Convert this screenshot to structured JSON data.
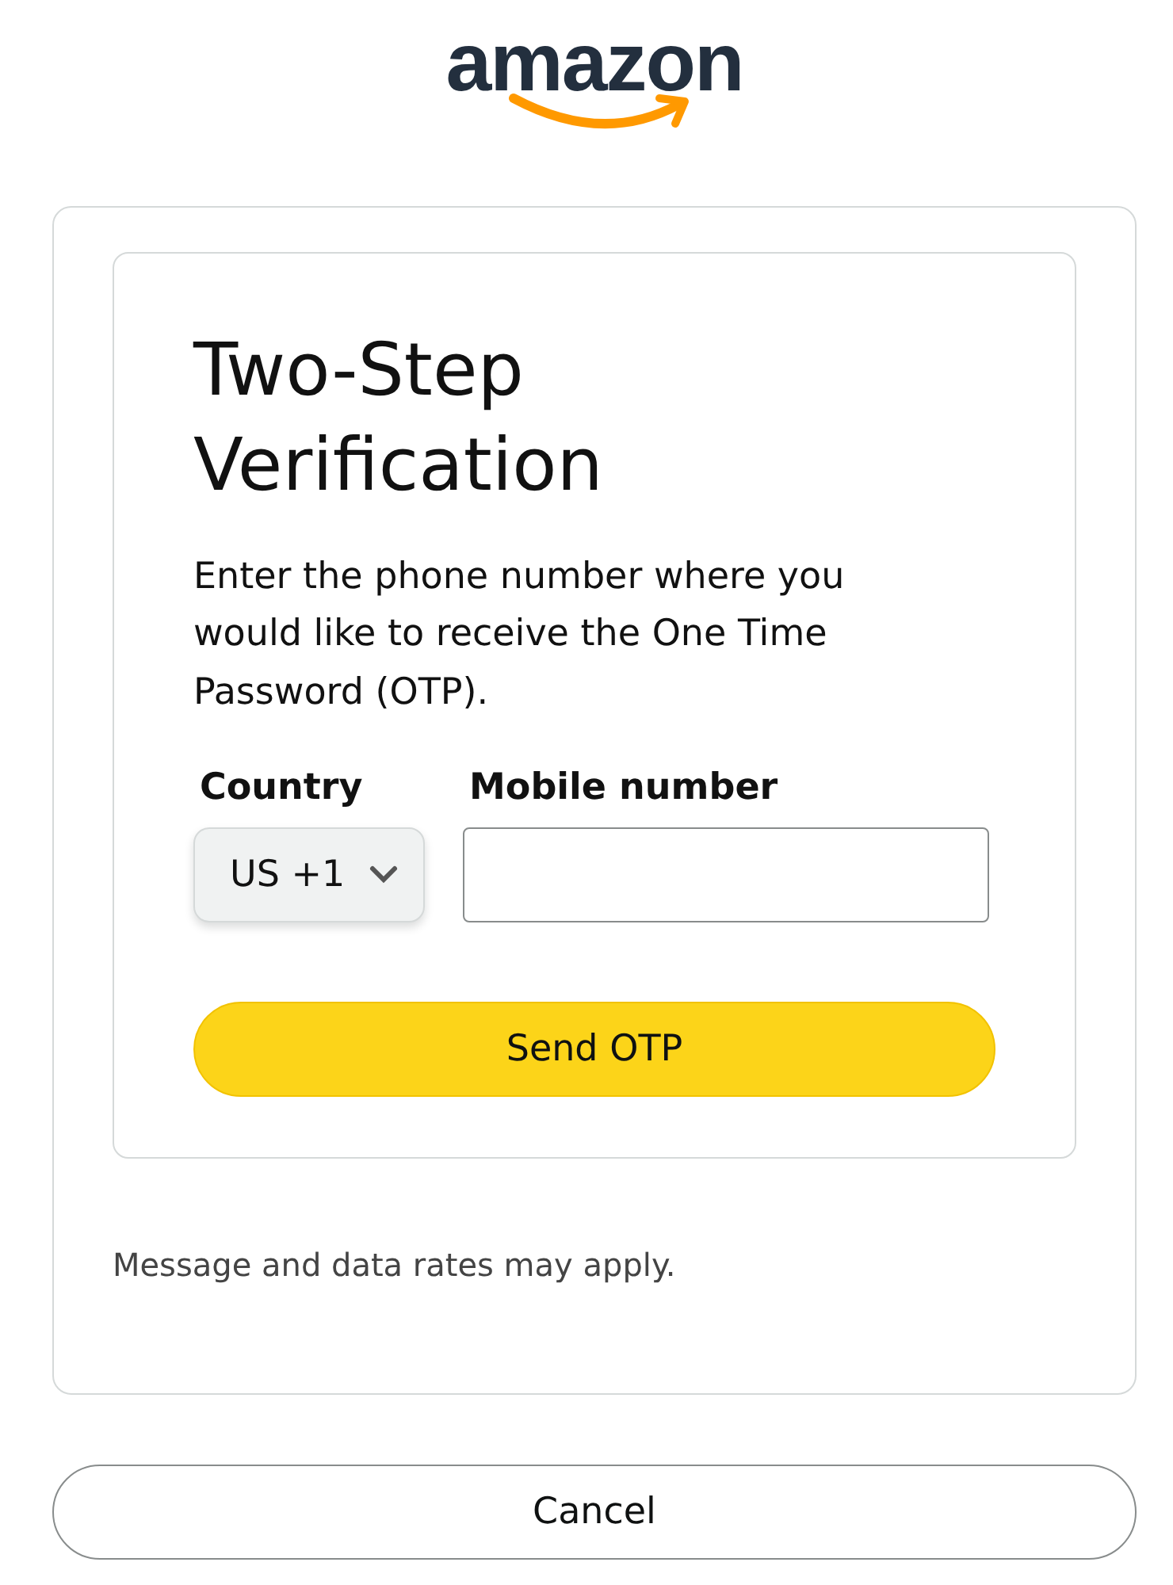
{
  "logo": {
    "text": "amazon"
  },
  "form": {
    "title": "Two-Step Verification",
    "description": "Enter the phone number where you would like to receive the One Time Password (OTP).",
    "country": {
      "label": "Country",
      "value": "US +1"
    },
    "mobile": {
      "label": "Mobile number"
    },
    "submit": "Send OTP"
  },
  "note": "Message and data rates may apply.",
  "cancel": "Cancel"
}
